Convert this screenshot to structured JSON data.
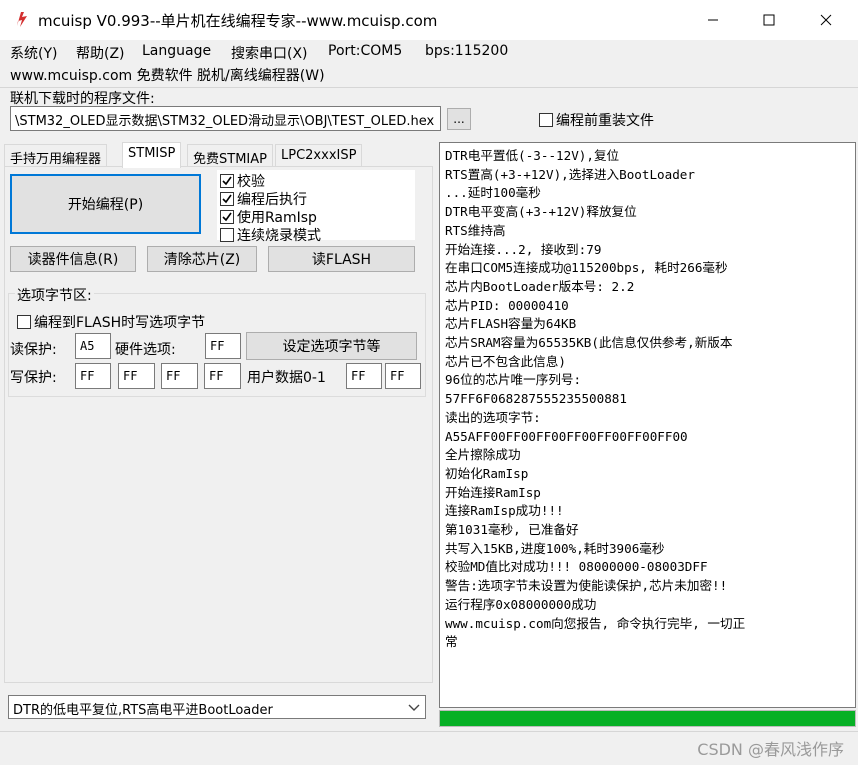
{
  "window": {
    "title": "mcuisp V0.993--单片机在线编程专家--www.mcuisp.com",
    "accent_icon_color": "#d32f2f"
  },
  "menu": {
    "items": [
      "系统(Y)",
      "帮助(Z)",
      "Language",
      "搜索串口(X)",
      "Port:COM5",
      "bps:115200"
    ],
    "second_row": "www.mcuisp.com 免费软件 脱机/离线编程器(W)"
  },
  "file": {
    "label": "联机下载时的程序文件:",
    "path": "\\STM32_OLED显示数据\\STM32_OLED滑动显示\\OBJ\\TEST_OLED.hex",
    "browse_label": "...",
    "reload_label": "编程前重装文件",
    "reload_checked": false
  },
  "tabs": [
    {
      "label": "手持万用编程器",
      "active": false
    },
    {
      "label": "STMISP",
      "active": true
    },
    {
      "label": "免费STMIAP",
      "active": false
    },
    {
      "label": "LPC2xxxISP",
      "active": false
    }
  ],
  "panel": {
    "start_label": "开始编程(P)",
    "options": [
      {
        "label": "校验",
        "checked": true
      },
      {
        "label": "编程后执行",
        "checked": true
      },
      {
        "label": "使用RamIsp",
        "checked": true
      },
      {
        "label": "连续烧录模式",
        "checked": false
      }
    ],
    "read_info_label": "读器件信息(R)",
    "erase_label": "清除芯片(Z)",
    "read_flash_label": "读FLASH",
    "option_group_title": "选项字节区:",
    "program_option_label": "编程到FLASH时写选项字节",
    "program_option_checked": false,
    "read_protect_label": "读保护:",
    "read_protect_value": "A5",
    "hw_option_label": "硬件选项:",
    "hw_option_value": "FF",
    "set_option_label": "设定选项字节等",
    "write_protect_label": "写保护:",
    "write_protect_values": [
      "FF",
      "FF",
      "FF",
      "FF"
    ],
    "user_data_label": "用户数据0-1",
    "user_data_values": [
      "FF",
      "FF"
    ],
    "reset_mode": "DTR的低电平复位,RTS高电平进BootLoader"
  },
  "log": {
    "lines": [
      "DTR电平置低(-3--12V),复位",
      "RTS置高(+3-+12V),选择进入BootLoader",
      "...延时100毫秒",
      "DTR电平变高(+3-+12V)释放复位",
      "RTS维持高",
      "开始连接...2, 接收到:79",
      "在串口COM5连接成功@115200bps, 耗时266毫秒",
      "芯片内BootLoader版本号: 2.2",
      "芯片PID: 00000410",
      "芯片FLASH容量为64KB",
      "芯片SRAM容量为65535KB(此信息仅供参考,新版本",
      "芯片已不包含此信息)",
      "96位的芯片唯一序列号:",
      "57FF6F068287555235500881",
      "读出的选项字节:",
      "A55AFF00FF00FF00FF00FF00FF00FF00",
      "全片擦除成功",
      "初始化RamIsp",
      "开始连接RamIsp",
      "连接RamIsp成功!!!",
      "第1031毫秒, 已准备好",
      "共写入15KB,进度100%,耗时3906毫秒",
      "校验MD值比对成功!!! 08000000-08003DFF",
      "警告:选项字节未设置为使能读保护,芯片未加密!!",
      "运行程序0x08000000成功",
      "www.mcuisp.com向您报告, 命令执行完毕, 一切正",
      "常"
    ]
  },
  "progress": {
    "value": 1.0,
    "color": "#06b025"
  },
  "watermark": "CSDN @春风浅作序"
}
